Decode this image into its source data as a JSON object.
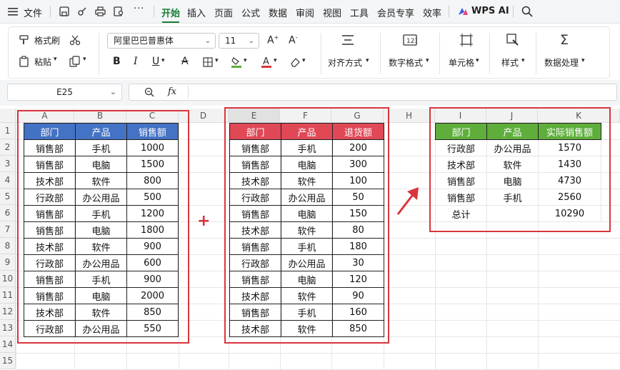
{
  "menubar": {
    "file": "文件",
    "tabs": [
      "开始",
      "插入",
      "页面",
      "公式",
      "数据",
      "审阅",
      "视图",
      "工具",
      "会员专享",
      "效率"
    ],
    "active_tab": "开始",
    "wps_ai": "WPS AI",
    "accent_color": "#1a7f37"
  },
  "ribbon": {
    "format_painter": "格式刷",
    "paste": "粘贴",
    "font_name": "阿里巴巴普惠体",
    "font_size": "11",
    "bold": "B",
    "italic": "I",
    "underline": "U",
    "align": "对齐方式",
    "number_format": "数字格式",
    "cell": "单元格",
    "style": "样式",
    "data_processing": "数据处理"
  },
  "formula_bar": {
    "cell_ref": "E25",
    "fx": "fx",
    "value": ""
  },
  "sheet": {
    "columns": [
      "A",
      "B",
      "C",
      "D",
      "E",
      "F",
      "G",
      "H",
      "I",
      "J",
      "K"
    ],
    "rows": [
      "1",
      "2",
      "3",
      "4",
      "5",
      "6",
      "7",
      "8",
      "9",
      "10",
      "11",
      "12",
      "13",
      "14",
      "15"
    ],
    "plus_sign": "+",
    "colors": {
      "table1_header": "#4472c4",
      "table2_header": "#e04856",
      "table3_header": "#5fae3b",
      "highlight_box": "#d9353d"
    }
  },
  "table1": {
    "headers": [
      "部门",
      "产品",
      "销售额"
    ],
    "rows": [
      [
        "销售部",
        "手机",
        "1000"
      ],
      [
        "销售部",
        "电脑",
        "1500"
      ],
      [
        "技术部",
        "软件",
        "800"
      ],
      [
        "行政部",
        "办公用品",
        "500"
      ],
      [
        "销售部",
        "手机",
        "1200"
      ],
      [
        "销售部",
        "电脑",
        "1800"
      ],
      [
        "技术部",
        "软件",
        "900"
      ],
      [
        "行政部",
        "办公用品",
        "600"
      ],
      [
        "销售部",
        "手机",
        "900"
      ],
      [
        "销售部",
        "电脑",
        "2000"
      ],
      [
        "技术部",
        "软件",
        "850"
      ],
      [
        "行政部",
        "办公用品",
        "550"
      ]
    ]
  },
  "table2": {
    "headers": [
      "部门",
      "产品",
      "退货额"
    ],
    "rows": [
      [
        "销售部",
        "手机",
        "200"
      ],
      [
        "销售部",
        "电脑",
        "300"
      ],
      [
        "技术部",
        "软件",
        "100"
      ],
      [
        "行政部",
        "办公用品",
        "50"
      ],
      [
        "销售部",
        "电脑",
        "150"
      ],
      [
        "技术部",
        "软件",
        "80"
      ],
      [
        "销售部",
        "手机",
        "180"
      ],
      [
        "行政部",
        "办公用品",
        "30"
      ],
      [
        "销售部",
        "电脑",
        "120"
      ],
      [
        "技术部",
        "软件",
        "90"
      ],
      [
        "销售部",
        "手机",
        "160"
      ],
      [
        "技术部",
        "软件",
        "850"
      ]
    ]
  },
  "table3": {
    "headers": [
      "部门",
      "产品",
      "实际销售额"
    ],
    "rows": [
      [
        "行政部",
        "办公用品",
        "1570"
      ],
      [
        "技术部",
        "软件",
        "1430"
      ],
      [
        "销售部",
        "电脑",
        "4730"
      ],
      [
        "销售部",
        "手机",
        "2560"
      ],
      [
        "总计",
        "",
        "10290"
      ]
    ]
  }
}
